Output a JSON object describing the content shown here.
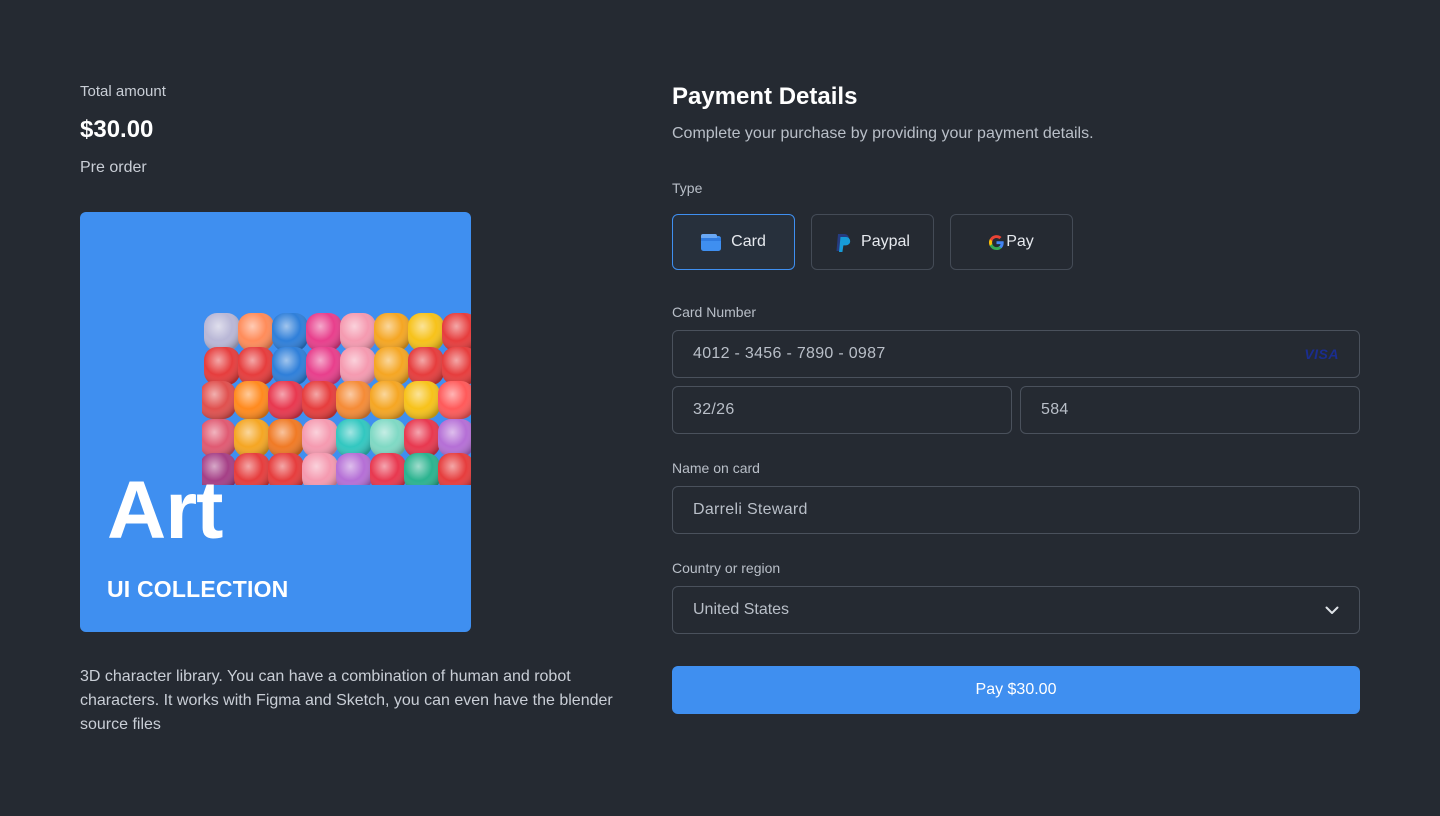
{
  "summary": {
    "total_label": "Total amount",
    "total_amount": "$30.00",
    "order_type": "Pre order"
  },
  "product": {
    "title": "Art",
    "subtitle": "UI COLLECTION",
    "description": "3D character library. You can have a combination of human and robot characters. It works with Figma and Sketch, you can even have the blender source files",
    "card_color": "#3f8ff0"
  },
  "payment": {
    "heading": "Payment Details",
    "subheading": "Complete your purchase by providing your payment details.",
    "type_label": "Type",
    "types": [
      {
        "label": "Card",
        "icon": "wallet-icon",
        "selected": true
      },
      {
        "label": "Paypal",
        "icon": "paypal-icon",
        "selected": false
      },
      {
        "label": "Pay",
        "icon": "google-icon",
        "selected": false
      }
    ],
    "card_number_label": "Card Number",
    "card_number_value": "4012 - 3456 - 7890 - 0987",
    "card_brand": "VISA",
    "expiry_value": "32/26",
    "cvc_value": "584",
    "name_label": "Name on card",
    "name_value": "Darreli Steward",
    "country_label": "Country or region",
    "country_value": "United States",
    "pay_button": "Pay $30.00"
  },
  "colors": {
    "background": "#252a32",
    "accent": "#3f8ff0",
    "border": "#4a515c"
  }
}
